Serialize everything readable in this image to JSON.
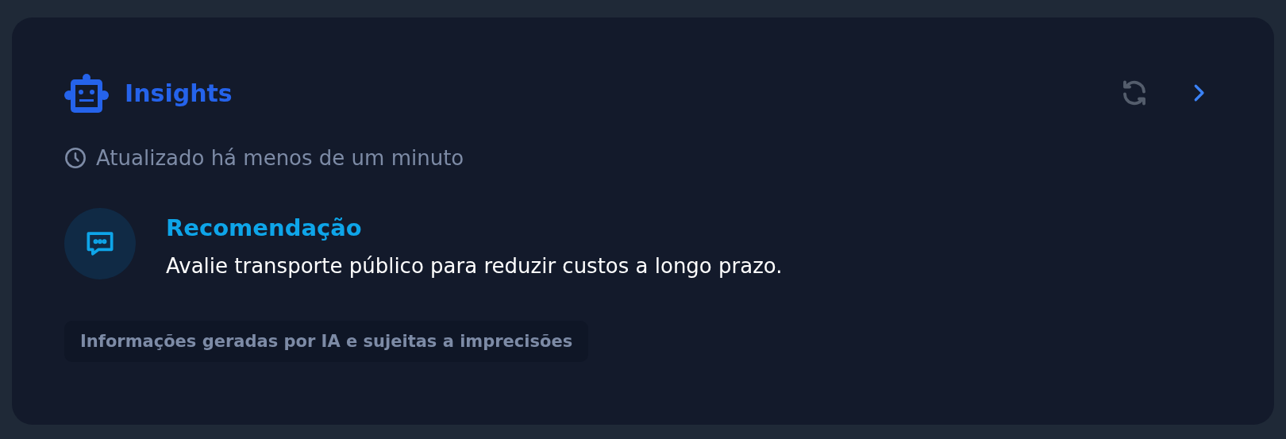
{
  "header": {
    "title": "Insights"
  },
  "updated": "Atualizado há menos de um minuto",
  "insights": [
    {
      "kind": "recommendation",
      "title": "Recomendação",
      "text": "Avalie transporte público para reduzir custos a longo prazo."
    }
  ],
  "disclaimer": "Informações geradas por IA e sujeitas a imprecisões"
}
